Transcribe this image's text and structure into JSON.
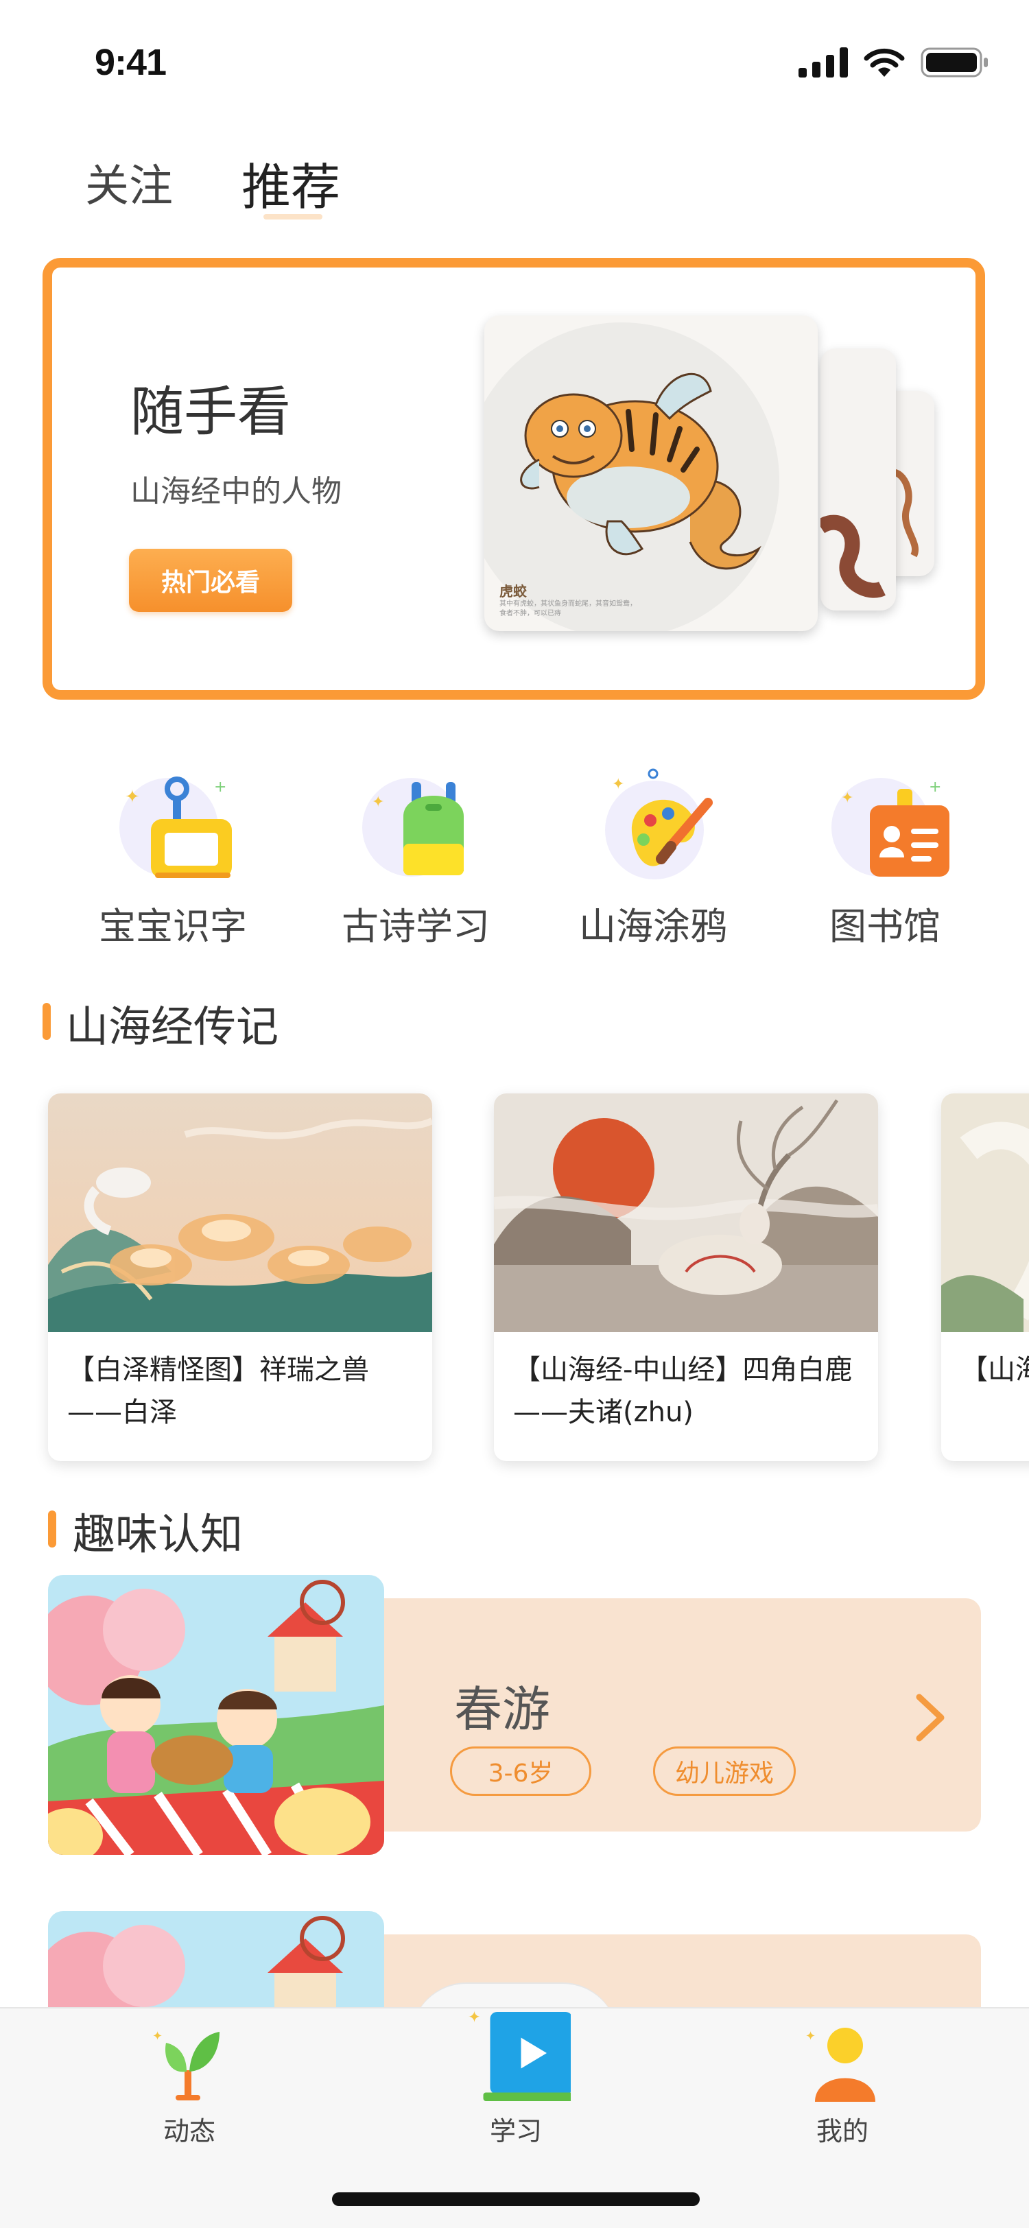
{
  "status_bar": {
    "time": "9:41"
  },
  "top_tabs": {
    "follow": "关注",
    "recommend": "推荐",
    "active": "recommend"
  },
  "banner": {
    "title": "随手看",
    "subtitle": "山海经中的人物",
    "button": "热门必看",
    "card_label": "虎蛟",
    "card_caption": "其中有虎蛟，其状鱼身而蛇尾，其音如鸳鸯，食者不肿，可以已痔"
  },
  "categories": [
    {
      "label": "宝宝识字",
      "icon": "easel-icon"
    },
    {
      "label": "古诗学习",
      "icon": "backpack-icon"
    },
    {
      "label": "山海涂鸦",
      "icon": "palette-icon"
    },
    {
      "label": "图书馆",
      "icon": "library-card-icon"
    }
  ],
  "legends_section": {
    "title": "山海经传记",
    "cards": [
      {
        "title": "【白泽精怪图】祥瑞之兽——白泽"
      },
      {
        "title": "【山海经-中山经】四角白鹿——夫诸(zhu)"
      },
      {
        "title": "【山海经】驱邪一"
      }
    ]
  },
  "fun_section": {
    "title": "趣味认知",
    "cards": [
      {
        "title": "春游",
        "tags": [
          "3-6岁",
          "幼儿游戏"
        ]
      }
    ]
  },
  "bottom_nav": [
    {
      "label": "动态",
      "icon": "sprout-icon"
    },
    {
      "label": "学习",
      "icon": "play-screen-icon",
      "active": true
    },
    {
      "label": "我的",
      "icon": "person-icon"
    }
  ],
  "colors": {
    "accent": "#fb9a36",
    "tag": "#ef8d2e",
    "card_bg": "#f9e3d0"
  }
}
